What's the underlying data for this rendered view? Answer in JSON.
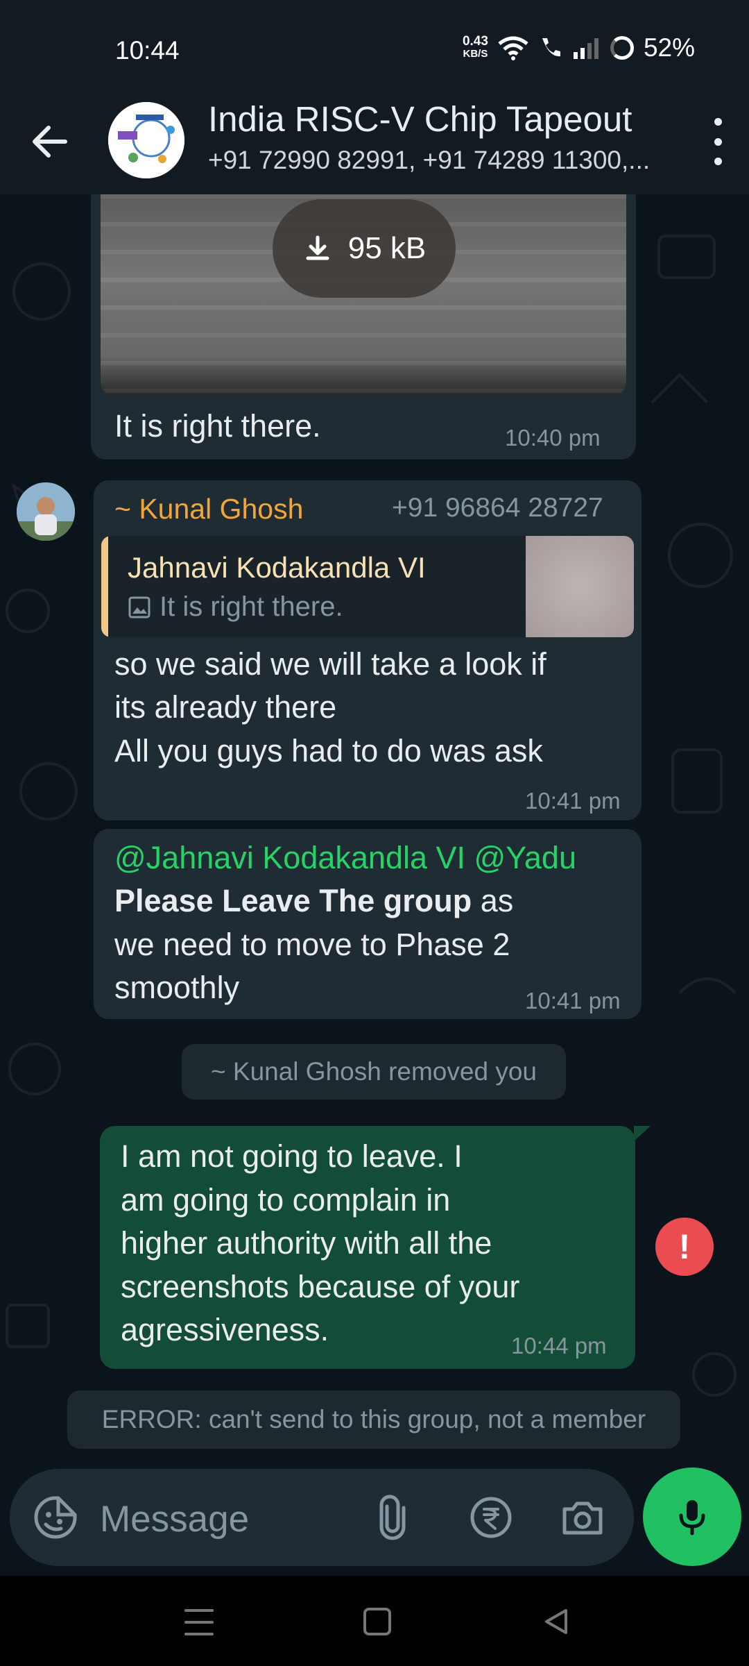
{
  "status_bar": {
    "time": "10:44",
    "net_speed_value": "0.43",
    "net_speed_unit": "KB/S",
    "battery": "52%"
  },
  "header": {
    "title": "India RISC-V Chip Tapeout",
    "members": "+91 72990 82991, +91 74289 11300,..."
  },
  "messages": {
    "m1": {
      "download_size": "95 kB",
      "caption": "It is right there.",
      "time": "10:40 pm"
    },
    "m2": {
      "sender_name": "~ Kunal Ghosh",
      "sender_phone": "+91 96864 28727",
      "quote_name": "Jahnavi Kodakandla VI",
      "quote_text": "It is right there.",
      "line1": "so we said we will take a look if",
      "line2": "its already there",
      "line3": "All you guys had to do was ask",
      "time": "10:41 pm"
    },
    "m3": {
      "mention1": "@Jahnavi Kodakandla VI",
      "mention2": "@Yadu",
      "bold_text": "Please Leave The group",
      "rest1": " as",
      "line2": "we need to move to Phase 2",
      "line3": "smoothly",
      "time": "10:41 pm"
    },
    "system": "~ Kunal Ghosh removed you",
    "m4": {
      "line1": "I am not going to leave. I",
      "line2": "am going to complain in",
      "line3": "higher authority with all the",
      "line4": "screenshots because of your",
      "line5": "agressiveness.",
      "time": "10:44 pm",
      "status_badge": "!"
    },
    "error": "ERROR: can't send to this group, not a member"
  },
  "input": {
    "placeholder": "Message"
  },
  "icons": {
    "back": "arrow-left-icon",
    "more": "more-vert-icon",
    "emoji": "sticker-emoji-icon",
    "attach": "paperclip-icon",
    "payment": "rupee-icon",
    "camera": "camera-icon",
    "mic": "microphone-icon"
  },
  "colors": {
    "accent_green": "#21c063",
    "outgoing_bubble": "#144d37",
    "incoming_bubble": "#202c33",
    "sender_name": "#f3a638",
    "mention": "#25d366",
    "error_badge": "#ea4c52"
  }
}
